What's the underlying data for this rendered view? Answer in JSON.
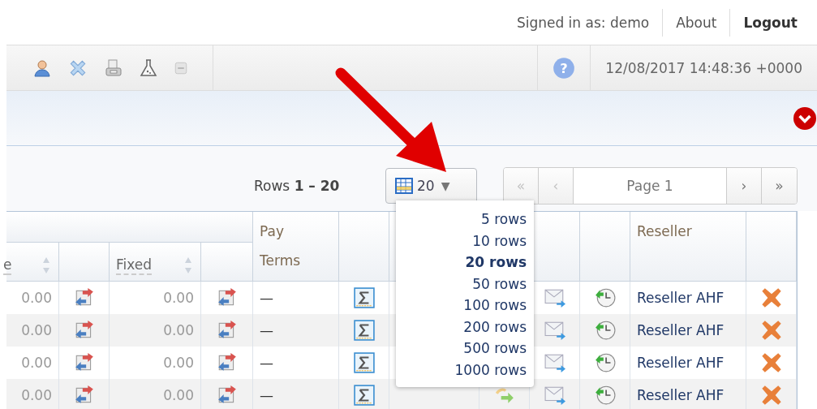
{
  "header": {
    "signed_in": "Signed in as: demo",
    "links": [
      {
        "label": "About",
        "bold": false
      },
      {
        "label": "Logout",
        "bold": true
      }
    ]
  },
  "toolbar": {
    "help": "?",
    "datetime": "12/08/2017 14:48:36 +0000"
  },
  "pager": {
    "rows_label": "Rows **1 – 20**",
    "page_size": "20",
    "caret": "▼",
    "first": "«",
    "prev": "‹",
    "page": "Page 1",
    "next": "›",
    "last": "»"
  },
  "page_size_menu": [
    {
      "label": "5 rows",
      "selected": false
    },
    {
      "label": "10 rows",
      "selected": false
    },
    {
      "label": "20 rows",
      "selected": true
    },
    {
      "label": "50 rows",
      "selected": false
    },
    {
      "label": "100 rows",
      "selected": false
    },
    {
      "label": "200 rows",
      "selected": false
    },
    {
      "label": "500 rows",
      "selected": false
    },
    {
      "label": "1000 rows",
      "selected": false
    }
  ],
  "table": {
    "headers": {
      "column_1": "e",
      "fixed": "Fixed",
      "pay_terms": "Pay Terms",
      "reseller": "Reseller"
    },
    "rows": [
      {
        "column_1": "0.00",
        "fixed": "0.00",
        "pay_terms": "—",
        "reseller": "Reseller AHF"
      },
      {
        "column_1": "0.00",
        "fixed": "0.00",
        "pay_terms": "—",
        "reseller": "Reseller AHF"
      },
      {
        "column_1": "0.00",
        "fixed": "0.00",
        "pay_terms": "—",
        "reseller": "Reseller AHF"
      },
      {
        "column_1": "0.00",
        "fixed": "0.00",
        "pay_terms": "—",
        "reseller": "Reseller AHF"
      }
    ]
  }
}
